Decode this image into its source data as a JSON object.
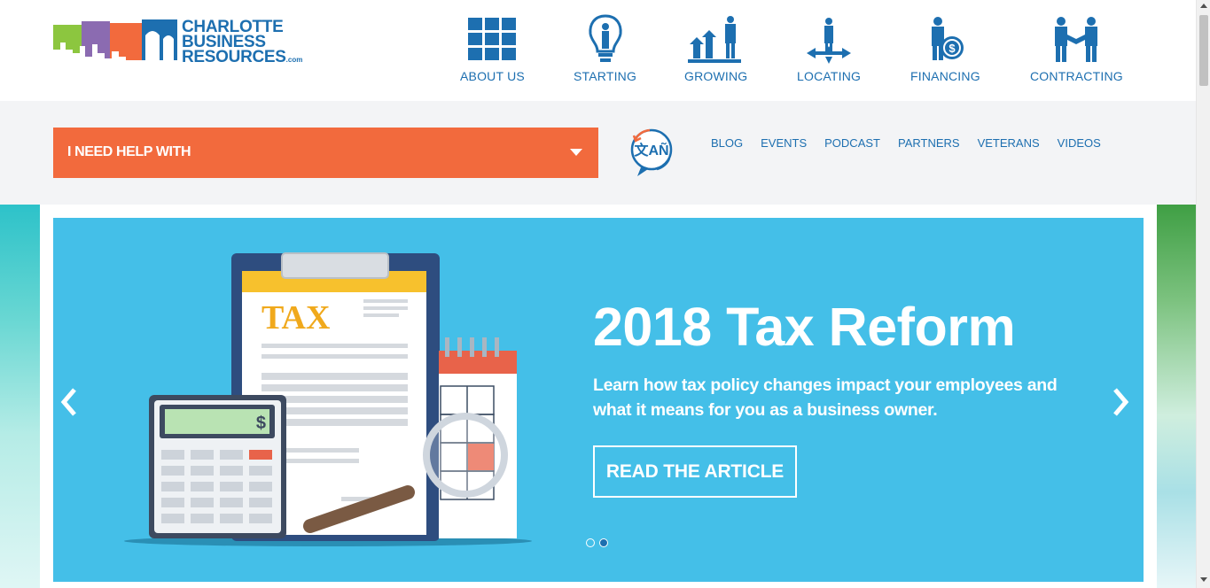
{
  "logo": {
    "line1": "CHARLOTTE",
    "line2": "BUSINESS",
    "line3": "RESOURCES",
    "suffix": ".com"
  },
  "nav": [
    {
      "label": "ABOUT US",
      "icon": "grid-icon"
    },
    {
      "label": "STARTING",
      "icon": "lightbulb-person-icon"
    },
    {
      "label": "GROWING",
      "icon": "growth-chart-icon"
    },
    {
      "label": "LOCATING",
      "icon": "location-person-icon"
    },
    {
      "label": "FINANCING",
      "icon": "finance-person-icon"
    },
    {
      "label": "CONTRACTING",
      "icon": "handshake-icon"
    }
  ],
  "help": {
    "label": "I NEED HELP WITH"
  },
  "language": {
    "icon": "translate-icon",
    "text": "文AÑ"
  },
  "sub_links": [
    "BLOG",
    "EVENTS",
    "PODCAST",
    "PARTNERS",
    "VETERANS",
    "VIDEOS"
  ],
  "hero": {
    "title": "2018 Tax Reform",
    "subtitle": "Learn how tax policy changes impact your employees and what it means for you as a business owner.",
    "cta": "READ THE ARTICLE",
    "illustration_text": "TAX",
    "calculator_symbol": "$",
    "slides": 2,
    "active_slide": 2
  },
  "colors": {
    "brand_blue": "#1d6fb0",
    "orange": "#f26a3d",
    "hero_bg": "#44bfe8",
    "subbar_bg": "#f3f4f6"
  }
}
